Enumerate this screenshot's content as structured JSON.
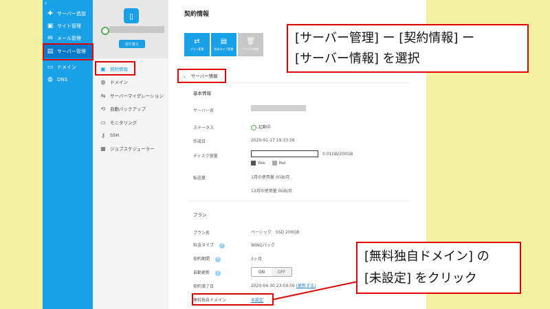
{
  "nav": {
    "back_glyph": "‹",
    "items": [
      {
        "label": "サーバー追加",
        "icon": "plus-icon"
      },
      {
        "label": "サイト管理",
        "icon": "window-icon"
      },
      {
        "label": "メール管理",
        "icon": "mail-icon"
      },
      {
        "label": "サーバー管理",
        "icon": "server-icon",
        "active": true
      },
      {
        "label": "ドメイン",
        "icon": "domain-icon"
      },
      {
        "label": "DNS",
        "icon": "globe-icon"
      }
    ]
  },
  "server_panel": {
    "switch_label": "切り替え",
    "menu": [
      {
        "label": "契約情報",
        "icon": "document-icon",
        "active": true
      },
      {
        "label": "ドメイン",
        "icon": "globe-icon"
      },
      {
        "label": "サーバーマイグレーション",
        "icon": "migration-icon"
      },
      {
        "label": "自動バックアップ",
        "icon": "backup-icon"
      },
      {
        "label": "モニタリング",
        "icon": "monitor-icon"
      },
      {
        "label": "SSH",
        "icon": "key-icon"
      },
      {
        "label": "ジョブスケジューラー",
        "icon": "scheduler-icon"
      }
    ]
  },
  "main": {
    "title": "契約情報",
    "tiles": [
      {
        "label": "プラン変更",
        "icon": "swap-icon"
      },
      {
        "label": "料金タイプ変更",
        "icon": "doc-icon"
      },
      {
        "label": "サーバー削除",
        "icon": "trash-icon",
        "disabled": true
      }
    ],
    "section_title": "サーバー情報",
    "basic": {
      "heading": "基本情報",
      "server_name_label": "サーバー名",
      "status_label": "ステータス",
      "status_value": "起動中",
      "created_label": "作成日",
      "created_value": "2020-01-17 19:33:56",
      "disk_label": "ディスク容量",
      "disk_value": "0.01GB/200GB",
      "disk_used_fraction": 0.0001,
      "legend_web": "Web",
      "legend_mail": "Mail",
      "transfer_label": "転送量",
      "transfer_month": "1月の使用量 0GB/月",
      "transfer_year": "12月の使用量 0GB/月"
    },
    "plan": {
      "heading": "プラン",
      "plan_name_label": "プラン名",
      "plan_name_value": "ベーシック　SSD 200GB",
      "fee_label": "料金タイプ",
      "fee_value": "WINGパック",
      "period_label": "契約期間",
      "period_value": "3ヶ月",
      "auto_label": "自動更新",
      "on_label": "ON",
      "off_label": "OFF",
      "end_label": "契約満了日",
      "end_value": "2020-04-30 23:59:59",
      "end_link": "(更新する)",
      "domain_label": "無料独自ドメイン",
      "domain_value": "未設定"
    }
  },
  "annotations": {
    "callout1": [
      "[サーバー管理] ー [契約情報] ー",
      "[サーバー情報] を選択"
    ],
    "callout2": [
      "[無料独自ドメイン] の",
      "[未設定] をクリック"
    ]
  },
  "colors": {
    "accent": "#1aa0e6",
    "highlight": "#e00000",
    "status_green": "#4caf50",
    "background_yellow": "#f5f1a3"
  }
}
